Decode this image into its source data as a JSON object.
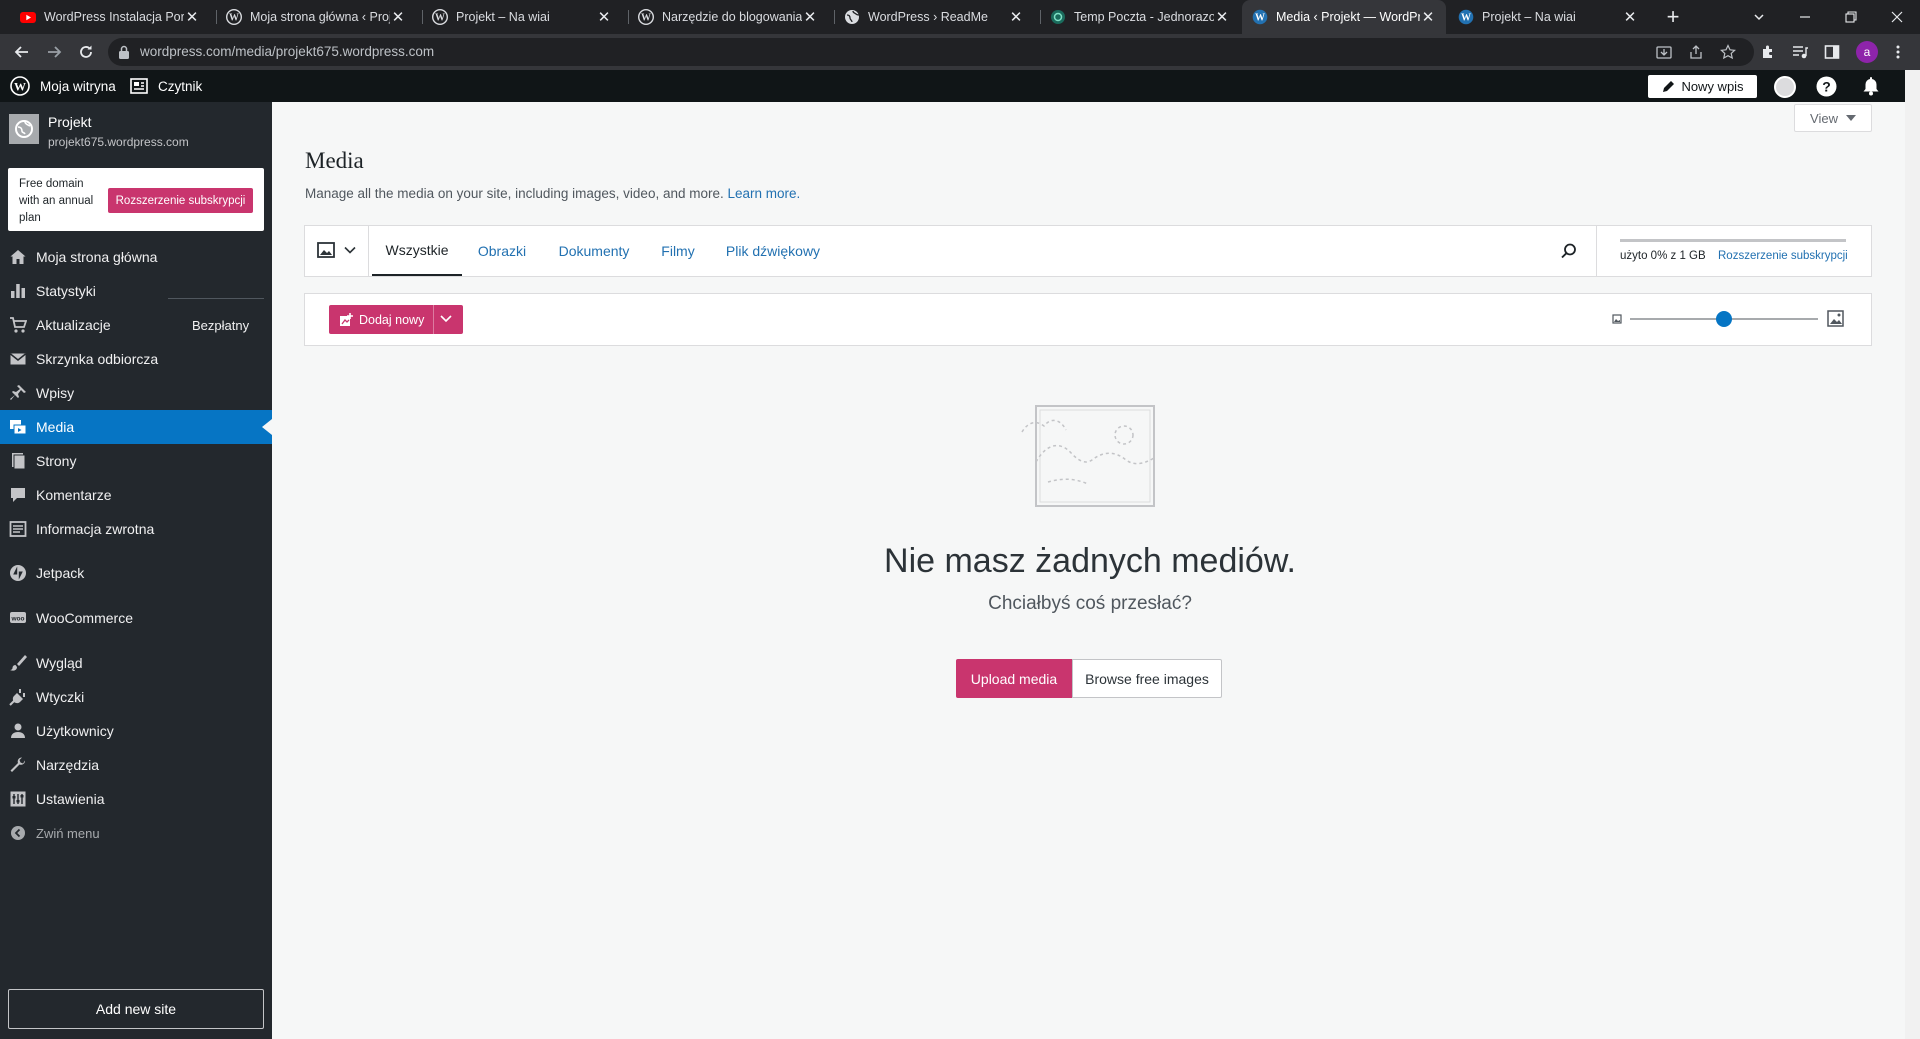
{
  "browser": {
    "tabs": [
      {
        "title": "WordPress Instalacja Porad",
        "favicon": "youtube-icon"
      },
      {
        "title": "Moja strona główna ‹ Proje",
        "favicon": "wordpress-icon"
      },
      {
        "title": "Projekt – Na wiai",
        "favicon": "wordpress-icon"
      },
      {
        "title": "Narzędzie do blogowania,",
        "favicon": "wordpress-icon"
      },
      {
        "title": "WordPress › ReadMe",
        "favicon": "globe-icon"
      },
      {
        "title": "Temp Poczta - Jednorazow",
        "favicon": "temp-mail-icon"
      },
      {
        "title": "Media ‹ Projekt — WordPr",
        "favicon": "wordpress-icon",
        "active": true
      },
      {
        "title": "Projekt – Na wiai",
        "favicon": "wordpress-icon"
      }
    ],
    "url": "wordpress.com/media/projekt675.wordpress.com",
    "profile_initial": "a"
  },
  "adminbar": {
    "my_site": "Moja witryna",
    "reader": "Czytnik",
    "new_post": "Nowy wpis"
  },
  "site": {
    "name": "Projekt",
    "domain": "projekt675.wordpress.com"
  },
  "promo": {
    "text": "Free domain with an annual plan",
    "button": "Rozszerzenie subskrypcji"
  },
  "sidebar": {
    "items": [
      {
        "label": "Moja strona główna",
        "icon": "home-icon"
      },
      {
        "label": "Statystyki",
        "icon": "stats-icon"
      },
      {
        "label": "Aktualizacje",
        "icon": "cart-icon",
        "badge": "Bezpłatny"
      },
      {
        "label": "Skrzynka odbiorcza",
        "icon": "mail-icon"
      },
      {
        "label": "Wpisy",
        "icon": "pin-icon"
      },
      {
        "label": "Media",
        "icon": "media-icon",
        "current": true
      },
      {
        "label": "Strony",
        "icon": "pages-icon"
      },
      {
        "label": "Komentarze",
        "icon": "comment-icon"
      },
      {
        "label": "Informacja zwrotna",
        "icon": "feedback-icon"
      },
      {
        "label": "Jetpack",
        "icon": "jetpack-icon"
      },
      {
        "label": "WooCommerce",
        "icon": "woo-icon"
      },
      {
        "label": "Wygląd",
        "icon": "brush-icon"
      },
      {
        "label": "Wtyczki",
        "icon": "plugin-icon"
      },
      {
        "label": "Użytkownicy",
        "icon": "user-icon"
      },
      {
        "label": "Narzędzia",
        "icon": "wrench-icon"
      },
      {
        "label": "Ustawienia",
        "icon": "settings-icon"
      }
    ],
    "collapse": "Zwiń menu",
    "add_site": "Add new site"
  },
  "main": {
    "view_button": "View",
    "title": "Media",
    "subtitle": "Manage all the media on your site, including images, video, and more.",
    "learn_more": "Learn more.",
    "filters": [
      "Wszystkie",
      "Obrazki",
      "Dokumenty",
      "Filmy",
      "Plik dźwiękowy"
    ],
    "active_filter": "Wszystkie",
    "storage": {
      "text": "użyto 0% z 1 GB",
      "upgrade": "Rozszerzenie subskrypcji",
      "used_fraction": 0.0
    },
    "add_new": "Dodaj nowy",
    "zoom_fraction": 0.5,
    "empty_title": "Nie masz żadnych mediów.",
    "empty_subtitle": "Chciałbyś coś przesłać?",
    "upload": "Upload media",
    "browse": "Browse free images"
  },
  "colors": {
    "accent_pink": "#c9356e",
    "link_blue": "#2271b1",
    "sidebar_bg": "#23282d",
    "current_item_bg": "#0675c4",
    "adminbar_bg": "#101517"
  }
}
